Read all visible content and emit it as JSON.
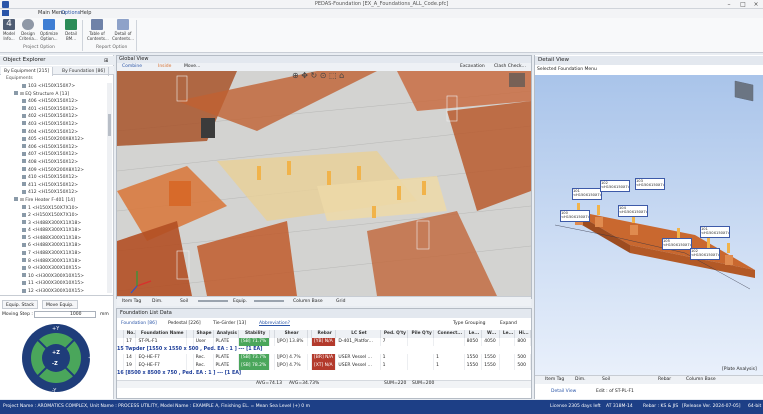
{
  "window": {
    "title": "PEDAS-Foundation [EX_A_Foundations_ALL_Code.pfc]"
  },
  "menu": {
    "items": [
      "Main Menu",
      "Options",
      "Help"
    ]
  },
  "ribbon": {
    "buttons": [
      {
        "label": "Model Info...",
        "icon": "model-info-icon",
        "color": "#4f5d73"
      },
      {
        "label": "Design Criteria...",
        "icon": "gear-icon",
        "color": "#6d7785"
      },
      {
        "label": "Optimize Option...",
        "icon": "optimize-icon",
        "color": "#3f7ed3"
      },
      {
        "label": "Detail BM...",
        "icon": "detail-bm-icon",
        "color": "#2b8b57"
      },
      {
        "label": "Table of Contents...",
        "icon": "table-icon",
        "color": "#6f82a8"
      },
      {
        "label": "Detail of Contents...",
        "icon": "document-icon",
        "color": "#8ea2c9"
      }
    ],
    "groups": [
      "Project Option",
      "Report Option"
    ]
  },
  "object_explorer": {
    "title": "Object Explorer",
    "tabs": [
      "By Equipment [215]",
      "By Foundation [86]"
    ],
    "section": "Equipments",
    "tree": [
      "103 <H150X150X7>",
      "⊟ EQ Structure A [13]",
      "406 <H150X150X12>",
      "401 <H150X150X12>",
      "402 <H150X150X12>",
      "403 <H150X150X12>",
      "404 <H150X150X12>",
      "405 <H150X200X8X12>",
      "406 <H150X150X12>",
      "407 <H150X150X12>",
      "408 <H150X150X12>",
      "409 <H150X200X8X12>",
      "410 <H150X150X12>",
      "411 <H150X150X12>",
      "412 <H150X150X12>",
      "⊟ Fire Heater F-401 [14]",
      "1 <H150X150X7X10>",
      "2 <H150X150X7X10>",
      "3 <H488X300X11X18>",
      "4 <H488X300X11X18>",
      "5 <H488X300X11X18>",
      "6 <H488X300X11X18>",
      "7 <H488X300X11X18>",
      "8 <H488X300X11X18>",
      "9 <H300X300X10X15>",
      "10 <H300X300X10X15>",
      "11 <H300X300X10X15>",
      "12 <H300X300X10X15>",
      "13 <H300X300X10X15>",
      "14 <H300X300X10X15>"
    ],
    "bottom_buttons": [
      "Equip. Stack",
      "Move Equip."
    ],
    "moving_step_label": "Moving Step :",
    "moving_step_value": "1000",
    "moving_step_unit": "mm",
    "dpad": [
      "+Y",
      "-Y",
      "+X",
      "-X",
      "+Z",
      "-Z"
    ]
  },
  "global_view": {
    "title": "Global View",
    "toolbar": [
      "Combine",
      "Inside",
      "Move..."
    ],
    "right_tools": [
      "Excavation",
      "Clash Check..."
    ],
    "bottom_tools": [
      "Item Tag",
      "Dim.",
      "Soil",
      "Equip.",
      "Column Base",
      "Grid"
    ]
  },
  "list": {
    "title": "Foundation List Data",
    "tabs": [
      "Foundation [86]",
      "Pedestal [226]",
      "Tie-Girder [13]",
      "Abbreviation?"
    ],
    "options": [
      "Type Grouping",
      "Expand"
    ],
    "headers": [
      "",
      "No.",
      "Foundation Name",
      "",
      "Shape",
      "Analysis",
      "Stability",
      "",
      "Shear",
      "",
      "Rebar",
      "LC Set",
      "Ped. Q'ty",
      "Pile Q'ty",
      "Connect...",
      "Le...",
      "W...",
      "Le...",
      "Hi..."
    ],
    "rows": [
      {
        "type": "row",
        "no": "17",
        "name": "ST-PL-F1",
        "shape": "User",
        "analysis": "PLATE",
        "stab": "[SB] 71.7%",
        "shear": "[JPO] 13.8%",
        "rebar": "[YB] N/A",
        "lc": "D-401_Platfor...",
        "ped": "7",
        "pile": "",
        "conn": "",
        "l1": "8050",
        "w1": "4050",
        "l2": "",
        "h": "800"
      },
      {
        "type": "group",
        "text": "15 Twpder [1550 x 1550 x 500 , Ped. EA : 1 ] --- [1 EA]"
      },
      {
        "type": "row",
        "no": "14",
        "name": "EQ-HE-F7",
        "shape": "Rec.",
        "analysis": "PLATE",
        "stab": "[SB] 73.7%",
        "shear": "[JPO] 4.7%",
        "rebar": "[BR] N/A",
        "lc": "USER Vessel ...",
        "ped": "1",
        "pile": "",
        "conn": "1",
        "l1": "1550",
        "w1": "1550",
        "l2": "",
        "h": "500"
      },
      {
        "type": "row",
        "no": "19",
        "name": "EQ-HE-F7",
        "shape": "Rec.",
        "analysis": "PLATE",
        "stab": "[SB] 78.2%",
        "shear": "[JPO] 4.7%",
        "rebar": "[XT] N/A",
        "lc": "USER Vessel ...",
        "ped": "1",
        "pile": "",
        "conn": "1",
        "l1": "1550",
        "w1": "1550",
        "l2": "",
        "h": "500"
      },
      {
        "type": "group",
        "text": "16 [8500 x 8500 x 750 , Ped. EA : 1 ] --- [1 EA]"
      }
    ],
    "summary": [
      "AVG=74.13",
      "AVG=34.73%",
      "SUM=220",
      "SUM=200"
    ]
  },
  "detail_view": {
    "title": "Detail View",
    "subtitle": "Selected Foundation Menu",
    "status_label": "[Plate Analysis]",
    "bottom_tools": [
      "Item Tag",
      "Dim.",
      "Soil",
      "Rebar",
      "Column Base"
    ],
    "footer": [
      "Detail View",
      "Edit : of ST-PL-F1"
    ],
    "labels": [
      "101 <H150X150X7>",
      "102 <H150X150X7>",
      "103 <H150X150X7>",
      "104 <H150X150X7>",
      "100 <H150X150X7>",
      "105 <H150X150X7>",
      "101 <H150X150X7>",
      "102 <H150X150X7>"
    ]
  },
  "status_bar": {
    "left": "Project Name : AROMATICS COMPLEX, Unit Name : PROCESS  UTILITY, Model Name : EXAMPLE A, Finishing EL. = Mean Sea Level (+) 0 m",
    "license": "License 2305 days left",
    "code": "AT 318M-14",
    "rebar": "Rebar : KS & JIS",
    "release": "[Release Ver. 2024-07-05]",
    "bits": "64-bit"
  },
  "colors": {
    "accent": "#1d3f86",
    "orange": "#d86f2d",
    "green": "#4aa65b",
    "blue_bg": "#c5d7f1"
  }
}
